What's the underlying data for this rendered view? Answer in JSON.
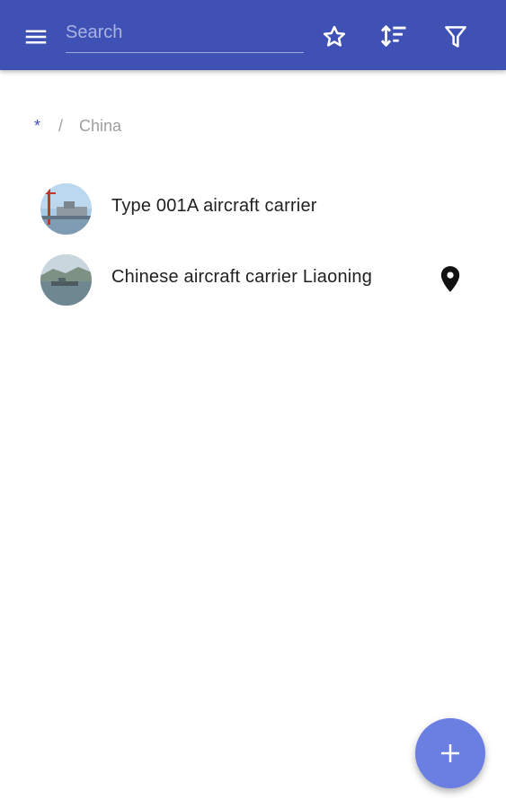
{
  "appbar": {
    "background": "#3f51b5",
    "menu_icon": "menu-icon",
    "search": {
      "placeholder": "Search",
      "value": ""
    },
    "actions": [
      {
        "icon": "star-outline-icon"
      },
      {
        "icon": "sort-icon"
      },
      {
        "icon": "filter-icon"
      }
    ]
  },
  "breadcrumb": {
    "root": "*",
    "separator": "/",
    "current": "China",
    "root_color": "#3f51b5"
  },
  "list": {
    "items": [
      {
        "label": "Type 001A aircraft carrier",
        "avatar_icon": "thumbnail-image",
        "has_location": false
      },
      {
        "label": "Chinese aircraft carrier Liaoning",
        "avatar_icon": "thumbnail-image",
        "has_location": true,
        "location_icon": "place-icon"
      }
    ]
  },
  "fab": {
    "icon": "add-icon",
    "color": "#6b7fe3"
  }
}
